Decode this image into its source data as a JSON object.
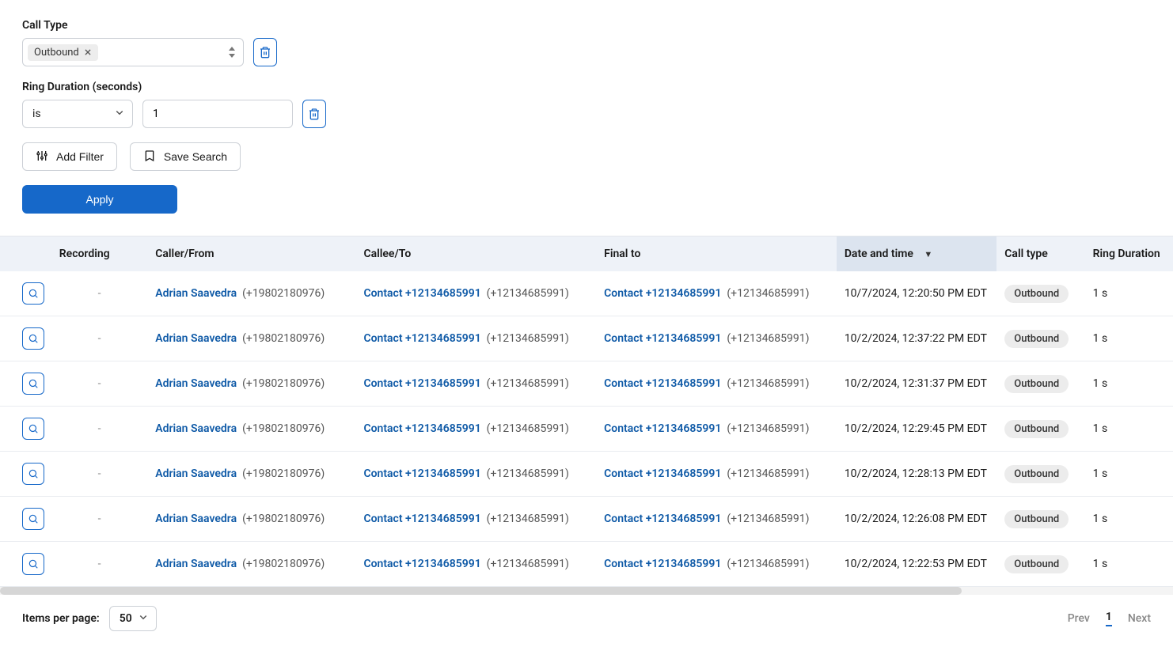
{
  "filters": {
    "call_type": {
      "label": "Call Type",
      "tag": "Outbound"
    },
    "ring_duration": {
      "label": "Ring Duration (seconds)",
      "operator": "is",
      "value": "1"
    }
  },
  "buttons": {
    "add_filter": "Add Filter",
    "save_search": "Save Search",
    "apply": "Apply"
  },
  "table": {
    "headers": {
      "recording": "Recording",
      "caller": "Caller/From",
      "callee": "Callee/To",
      "final_to": "Final to",
      "date": "Date and time",
      "call_type": "Call type",
      "ring_duration": "Ring Duration"
    },
    "rows": [
      {
        "recording": "-",
        "caller_name": "Adrian Saavedra",
        "caller_phone": "(+19802180976)",
        "callee_name": "Contact +12134685991",
        "callee_phone": "(+12134685991)",
        "final_name": "Contact +12134685991",
        "final_phone": "(+12134685991)",
        "date": "10/7/2024, 12:20:50 PM EDT",
        "call_type": "Outbound",
        "ring_duration": "1 s"
      },
      {
        "recording": "-",
        "caller_name": "Adrian Saavedra",
        "caller_phone": "(+19802180976)",
        "callee_name": "Contact +12134685991",
        "callee_phone": "(+12134685991)",
        "final_name": "Contact +12134685991",
        "final_phone": "(+12134685991)",
        "date": "10/2/2024, 12:37:22 PM EDT",
        "call_type": "Outbound",
        "ring_duration": "1 s"
      },
      {
        "recording": "-",
        "caller_name": "Adrian Saavedra",
        "caller_phone": "(+19802180976)",
        "callee_name": "Contact +12134685991",
        "callee_phone": "(+12134685991)",
        "final_name": "Contact +12134685991",
        "final_phone": "(+12134685991)",
        "date": "10/2/2024, 12:31:37 PM EDT",
        "call_type": "Outbound",
        "ring_duration": "1 s"
      },
      {
        "recording": "-",
        "caller_name": "Adrian Saavedra",
        "caller_phone": "(+19802180976)",
        "callee_name": "Contact +12134685991",
        "callee_phone": "(+12134685991)",
        "final_name": "Contact +12134685991",
        "final_phone": "(+12134685991)",
        "date": "10/2/2024, 12:29:45 PM EDT",
        "call_type": "Outbound",
        "ring_duration": "1 s"
      },
      {
        "recording": "-",
        "caller_name": "Adrian Saavedra",
        "caller_phone": "(+19802180976)",
        "callee_name": "Contact +12134685991",
        "callee_phone": "(+12134685991)",
        "final_name": "Contact +12134685991",
        "final_phone": "(+12134685991)",
        "date": "10/2/2024, 12:28:13 PM EDT",
        "call_type": "Outbound",
        "ring_duration": "1 s"
      },
      {
        "recording": "-",
        "caller_name": "Adrian Saavedra",
        "caller_phone": "(+19802180976)",
        "callee_name": "Contact +12134685991",
        "callee_phone": "(+12134685991)",
        "final_name": "Contact +12134685991",
        "final_phone": "(+12134685991)",
        "date": "10/2/2024, 12:26:08 PM EDT",
        "call_type": "Outbound",
        "ring_duration": "1 s"
      },
      {
        "recording": "-",
        "caller_name": "Adrian Saavedra",
        "caller_phone": "(+19802180976)",
        "callee_name": "Contact +12134685991",
        "callee_phone": "(+12134685991)",
        "final_name": "Contact +12134685991",
        "final_phone": "(+12134685991)",
        "date": "10/2/2024, 12:22:53 PM EDT",
        "call_type": "Outbound",
        "ring_duration": "1 s"
      }
    ]
  },
  "footer": {
    "items_per_page_label": "Items per page:",
    "items_per_page_value": "50",
    "prev": "Prev",
    "current_page": "1",
    "next": "Next"
  }
}
